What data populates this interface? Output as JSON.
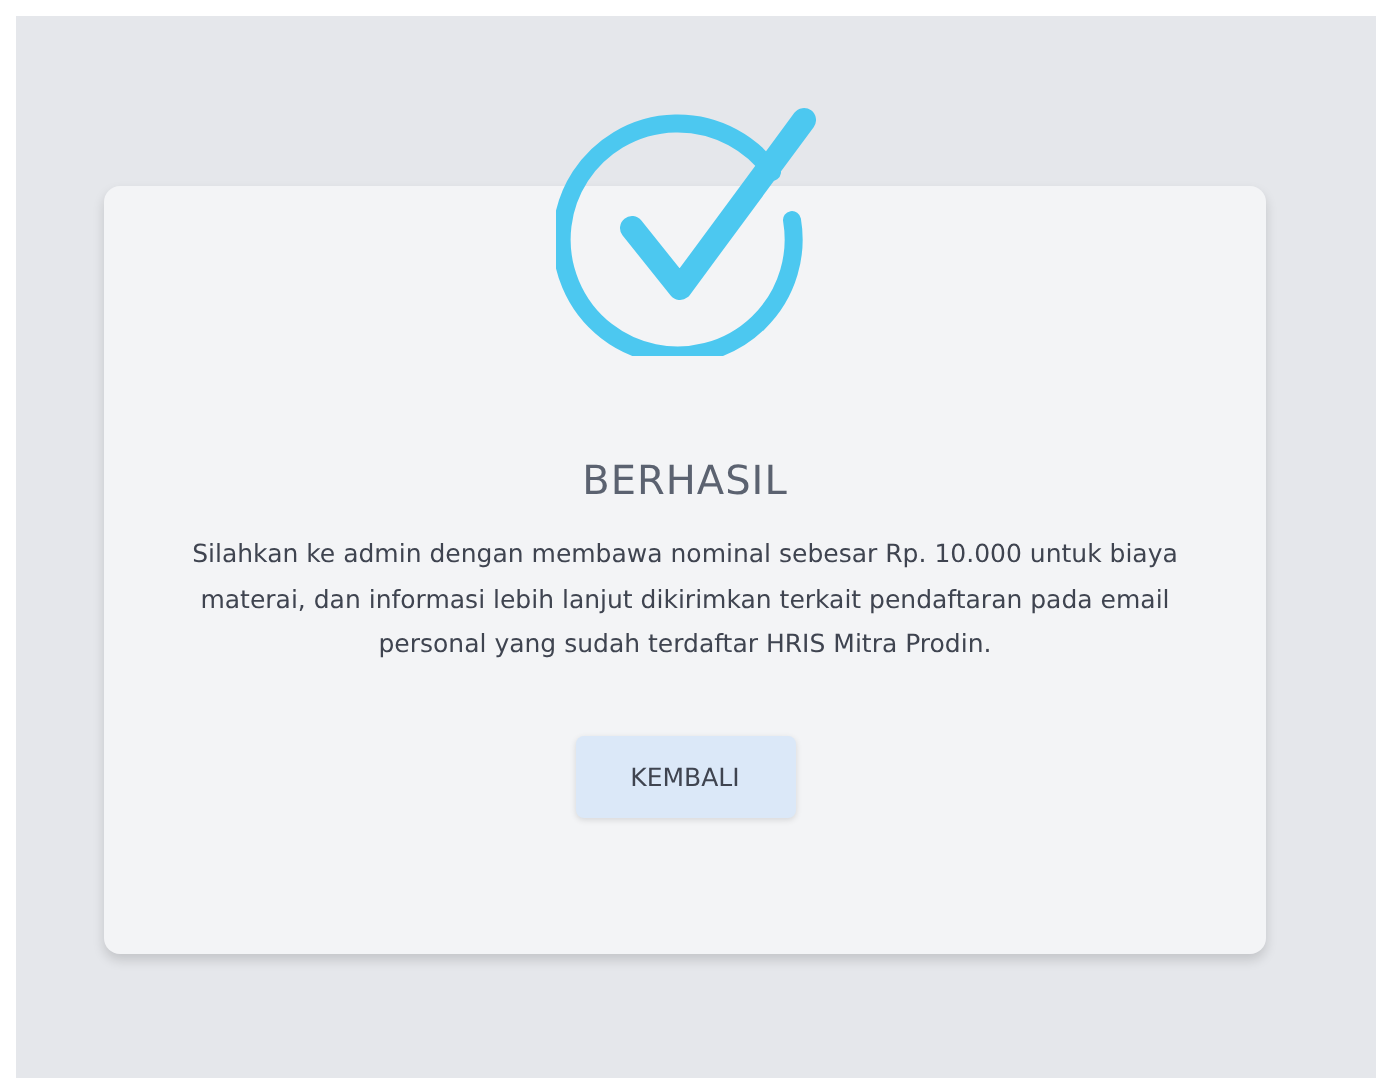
{
  "dialog": {
    "title": "BERHASIL",
    "message": "Silahkan ke admin dengan membawa nominal sebesar Rp. 10.000 untuk biaya materai, dan informasi lebih lanjut dikirimkan terkait pendaftaran pada email personal yang sudah terdaftar HRIS Mitra Prodin.",
    "button": "KEMBALI"
  }
}
